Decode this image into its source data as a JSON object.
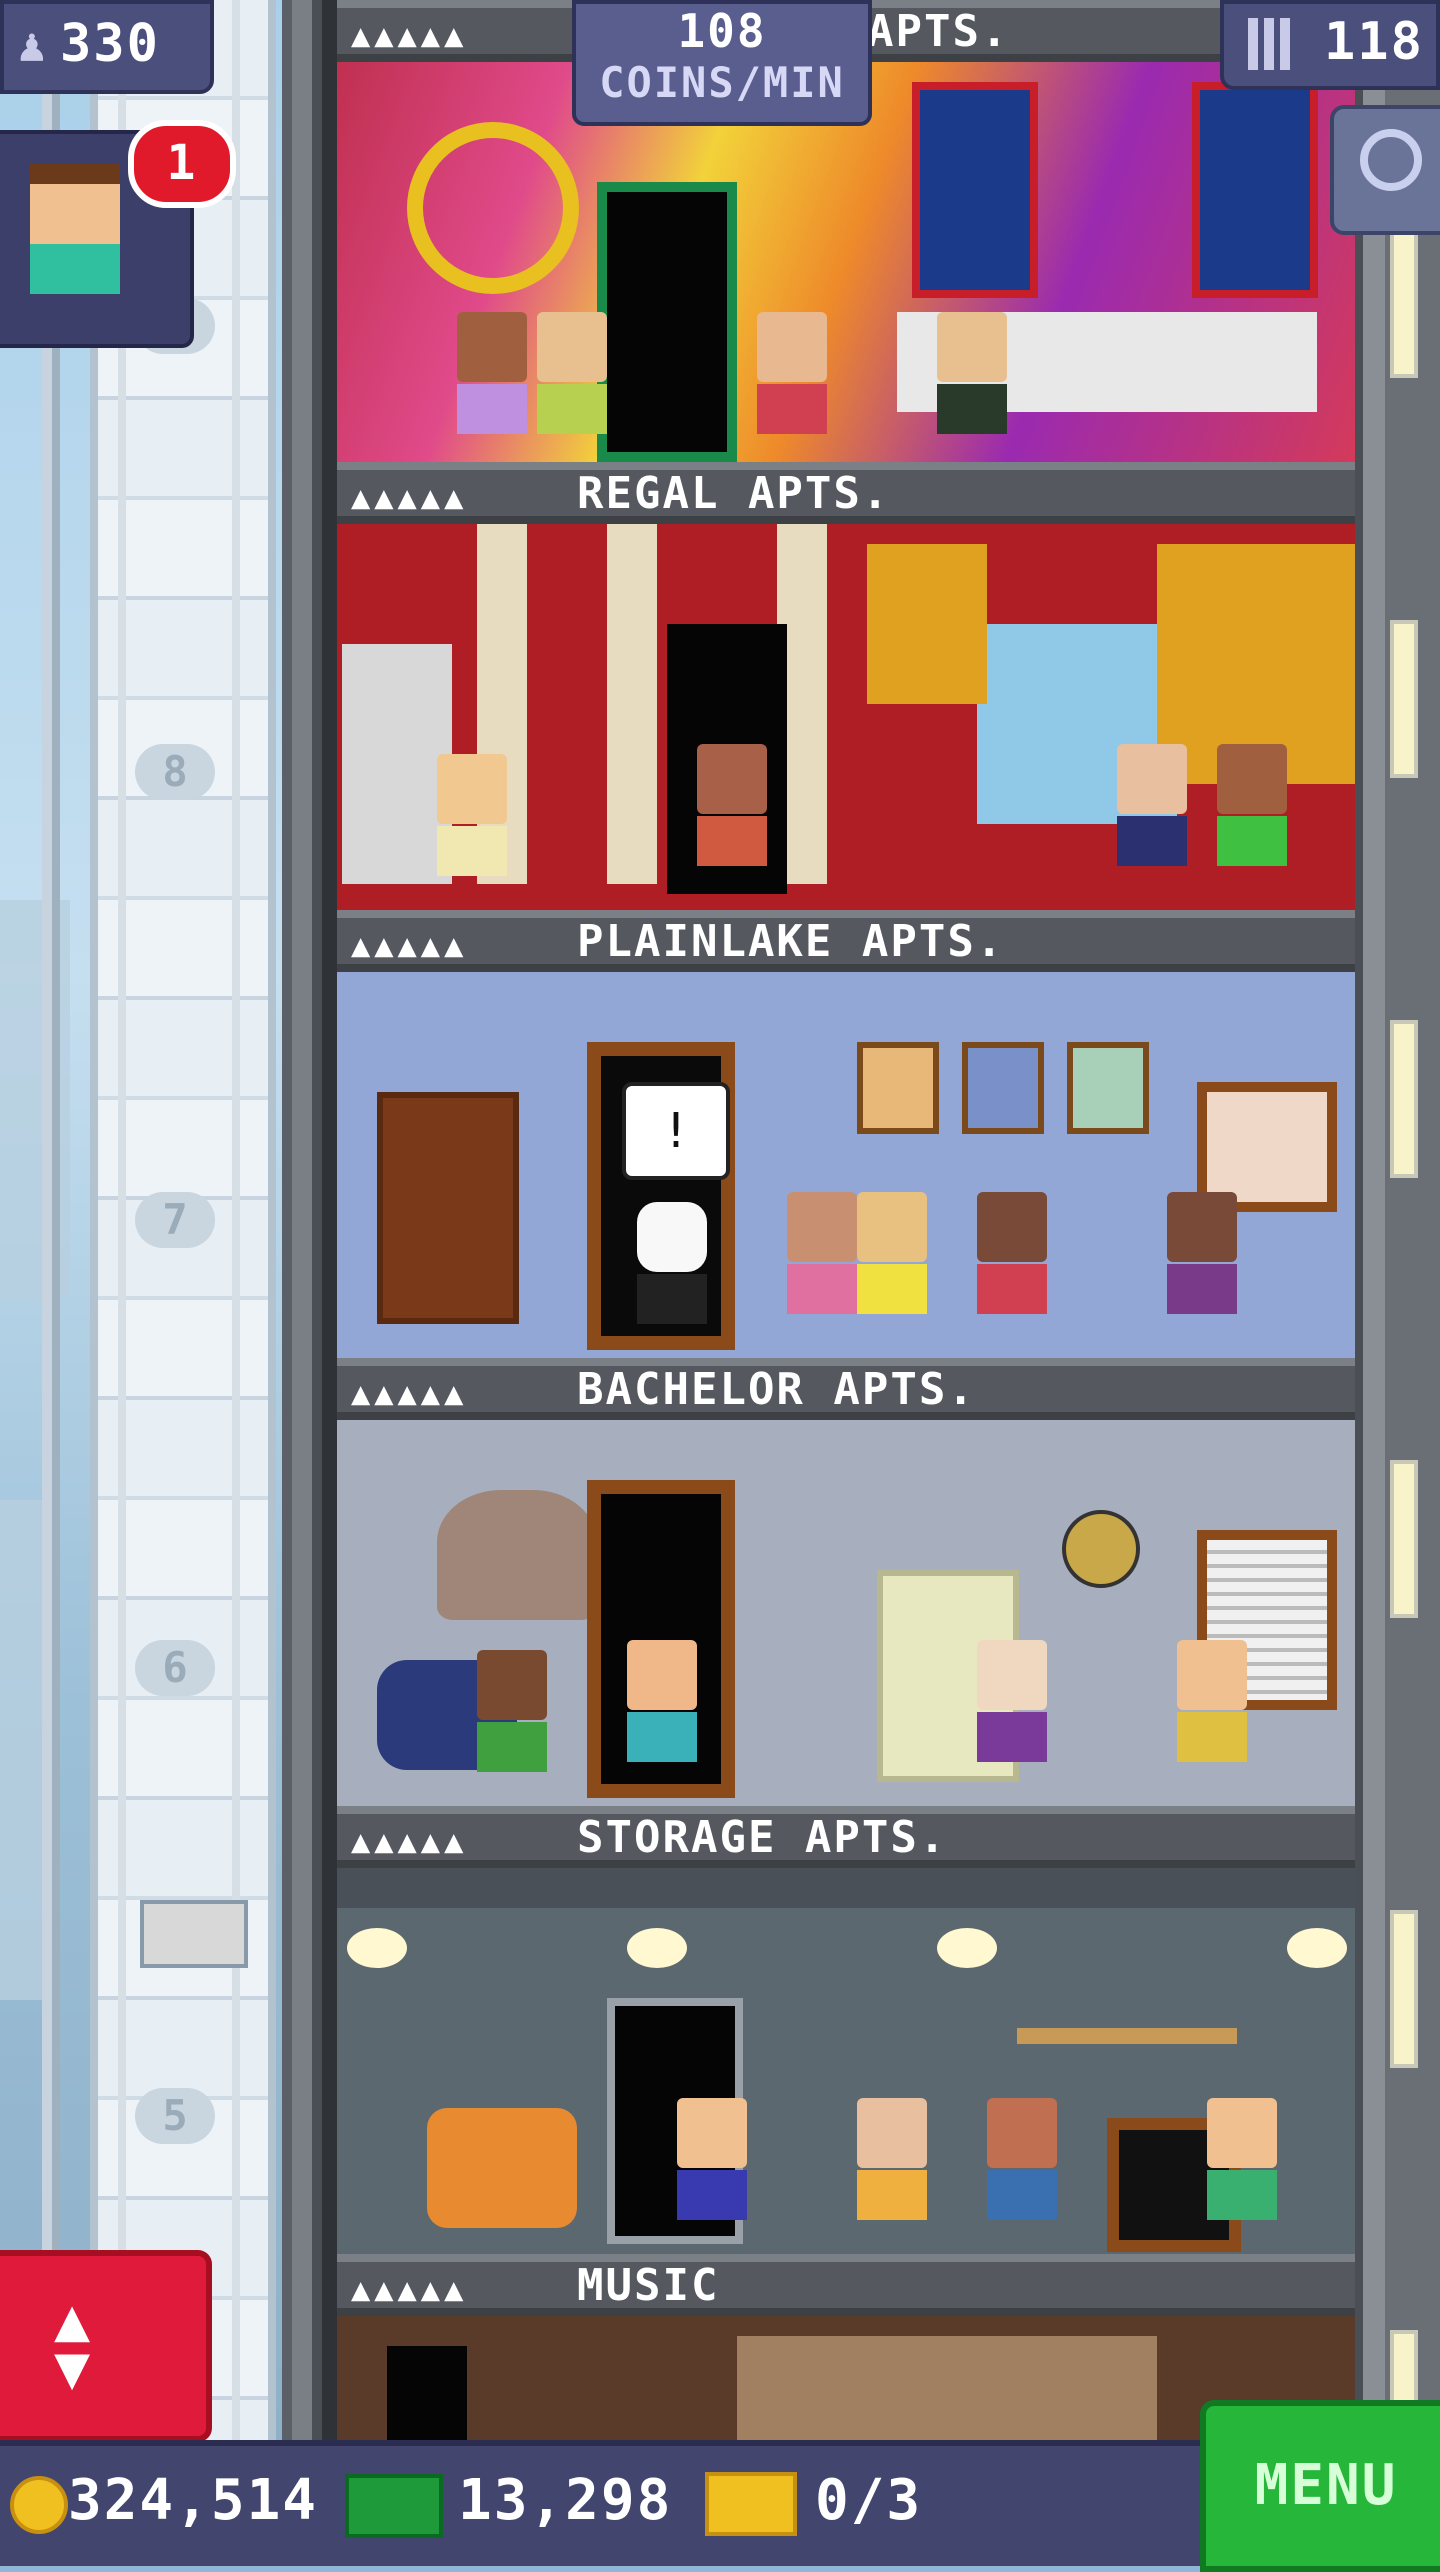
{
  "hud": {
    "population": "330",
    "floors": "118",
    "coins_per_min_value": "108",
    "coins_per_min_label": "COINS/MIN",
    "visitor_badge": "1"
  },
  "floors": [
    {
      "name": "APTS.",
      "stars": "▲▲▲▲▲"
    },
    {
      "name": "REGAL APTS.",
      "stars": "▲▲▲▲▲"
    },
    {
      "name": "PLAINLAKE APTS.",
      "stars": "▲▲▲▲▲"
    },
    {
      "name": "BACHELOR APTS.",
      "stars": "▲▲▲▲▲"
    },
    {
      "name": "STORAGE APTS.",
      "stars": "▲▲▲▲▲"
    },
    {
      "name": "MUSIC",
      "stars": "▲▲▲▲▲"
    }
  ],
  "elevator_floor_numbers": [
    "9",
    "8",
    "7",
    "6",
    "5"
  ],
  "exclamation": "!",
  "bottom_bar": {
    "coins": "324,514",
    "bux": "13,298",
    "tickets": "0/3",
    "menu_label": "MENU"
  },
  "colors": {
    "hud_bg": "#4b4f7c",
    "menu_green": "#26b63a",
    "elevator_red": "#e01a3a",
    "badge_red": "#e01a2a"
  }
}
